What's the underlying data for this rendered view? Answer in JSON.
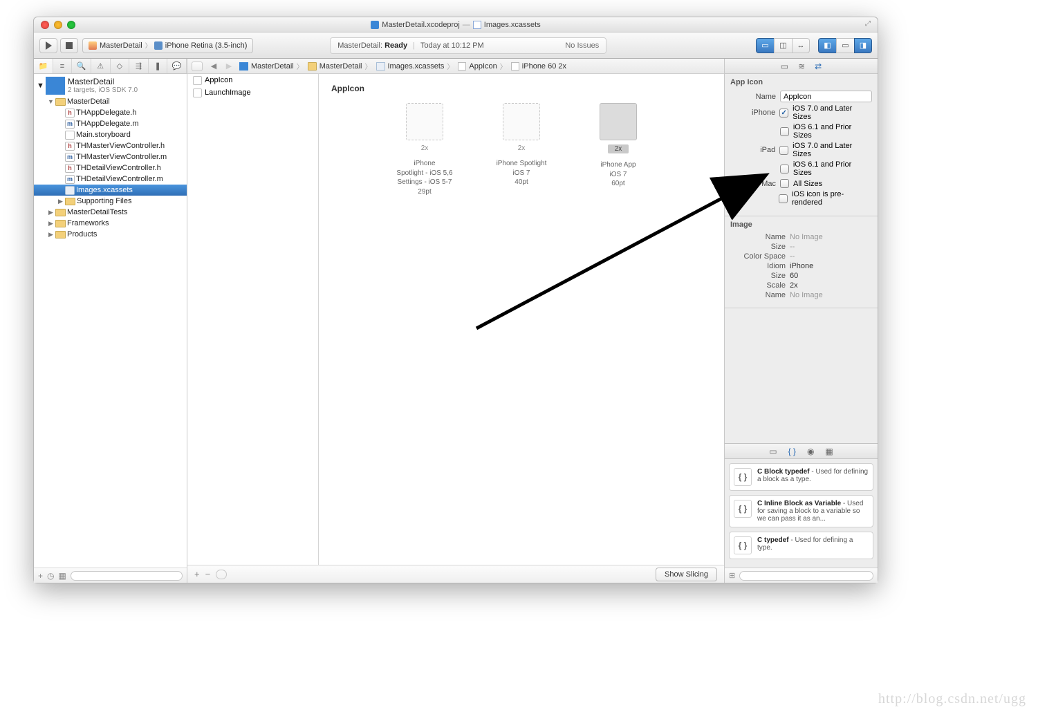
{
  "title": {
    "project_file": "MasterDetail.xcodeproj",
    "separator": "—",
    "asset_file": "Images.xcassets"
  },
  "toolbar": {
    "scheme_app": "MasterDetail",
    "scheme_device": "iPhone Retina (3.5-inch)",
    "status_prefix": "MasterDetail:",
    "status_state": "Ready",
    "status_time": "Today at 10:12 PM",
    "status_issues": "No Issues"
  },
  "navigator": {
    "project": {
      "name": "MasterDetail",
      "subtitle": "2 targets, iOS SDK 7.0"
    },
    "tree": [
      {
        "name": "MasterDetail",
        "kind": "folder",
        "expanded": true,
        "depth": 1,
        "children": [
          {
            "name": "THAppDelegate.h",
            "kind": "h",
            "depth": 2
          },
          {
            "name": "THAppDelegate.m",
            "kind": "m",
            "depth": 2
          },
          {
            "name": "Main.storyboard",
            "kind": "sb",
            "depth": 2
          },
          {
            "name": "THMasterViewController.h",
            "kind": "h",
            "depth": 2
          },
          {
            "name": "THMasterViewController.m",
            "kind": "m",
            "depth": 2
          },
          {
            "name": "THDetailViewController.h",
            "kind": "h",
            "depth": 2
          },
          {
            "name": "THDetailViewController.m",
            "kind": "m",
            "depth": 2
          },
          {
            "name": "Images.xcassets",
            "kind": "xc",
            "depth": 2,
            "selected": true
          },
          {
            "name": "Supporting Files",
            "kind": "folder",
            "depth": 2,
            "expandable": true
          }
        ]
      },
      {
        "name": "MasterDetailTests",
        "kind": "folder",
        "expandable": true,
        "depth": 1
      },
      {
        "name": "Frameworks",
        "kind": "folder",
        "expandable": true,
        "depth": 1
      },
      {
        "name": "Products",
        "kind": "folder",
        "expandable": true,
        "depth": 1
      }
    ]
  },
  "jumpbar": [
    {
      "label": "MasterDetail",
      "kind": "proj"
    },
    {
      "label": "MasterDetail",
      "kind": "folder"
    },
    {
      "label": "Images.xcassets",
      "kind": "xc"
    },
    {
      "label": "AppIcon",
      "kind": "box"
    },
    {
      "label": "iPhone 60 2x",
      "kind": "box"
    }
  ],
  "asset_list": [
    {
      "name": "AppIcon"
    },
    {
      "name": "LaunchImage"
    }
  ],
  "asset_group": {
    "name": "AppIcon",
    "slots": [
      {
        "scale": "2x",
        "lines": [
          "iPhone",
          "Spotlight - iOS 5,6",
          "Settings - iOS 5-7",
          "29pt"
        ]
      },
      {
        "scale": "2x",
        "lines": [
          "iPhone Spotlight",
          "iOS 7",
          "40pt"
        ]
      },
      {
        "scale": "2x",
        "lines": [
          "iPhone App",
          "iOS 7",
          "60pt"
        ],
        "selected": true
      }
    ],
    "show_slicing": "Show Slicing"
  },
  "inspector": {
    "appicon": {
      "header": "App Icon",
      "name_label": "Name",
      "name_value": "AppIcon",
      "iphone_label": "iPhone",
      "ipad_label": "iPad",
      "mac_label": "Mac",
      "ios7_later": "iOS 7.0 and Later Sizes",
      "ios61_prior": "iOS 6.1 and Prior Sizes",
      "all_sizes": "All Sizes",
      "prerendered": "iOS icon is pre-rendered",
      "iphone_ios7_checked": true
    },
    "image": {
      "header": "Image",
      "rows": [
        {
          "label": "Name",
          "value": "No Image",
          "muted": true
        },
        {
          "label": "Size",
          "value": "--",
          "muted": true
        },
        {
          "label": "Color Space",
          "value": "--",
          "muted": true
        },
        {
          "label": "Idiom",
          "value": "iPhone"
        },
        {
          "label": "Size",
          "value": "60"
        },
        {
          "label": "Scale",
          "value": "2x"
        },
        {
          "label": "Name",
          "value": "No Image",
          "muted": true
        }
      ]
    }
  },
  "library": {
    "snippets": [
      {
        "title": "C Block typedef",
        "desc": " - Used for defining a block as a type."
      },
      {
        "title": "C Inline Block as Variable",
        "desc": " - Used for saving a block to a variable so we can pass it as an..."
      },
      {
        "title": "C typedef",
        "desc": " - Used for defining a type."
      }
    ]
  },
  "watermark": "http://blog.csdn.net/ugg"
}
